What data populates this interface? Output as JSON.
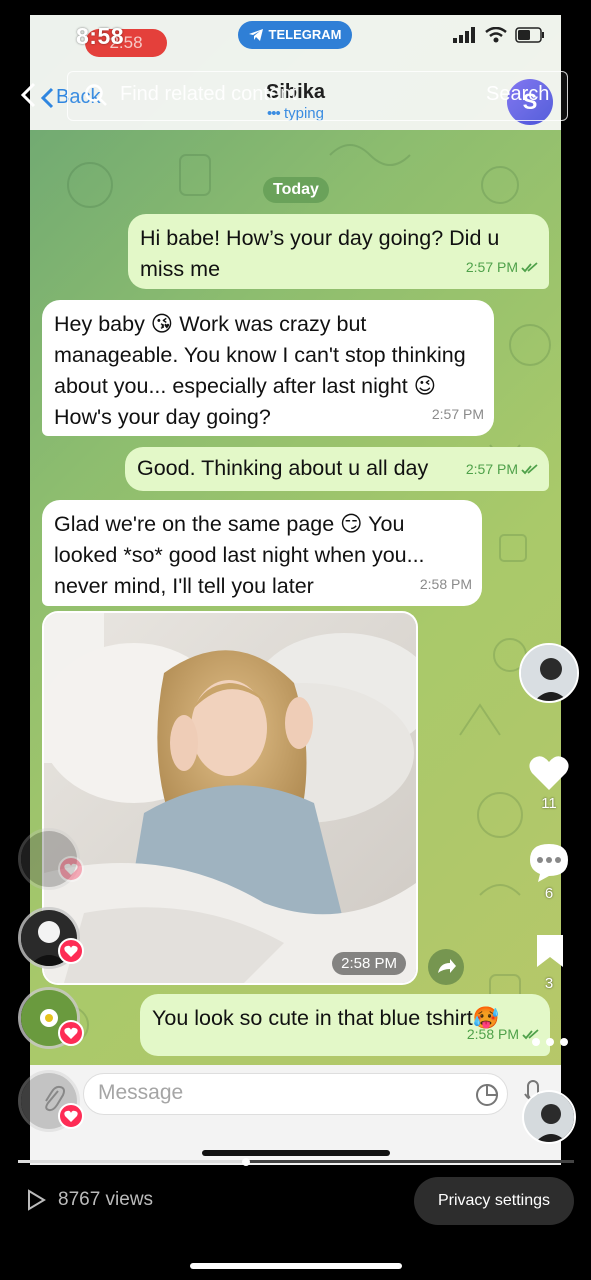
{
  "status_bar": {
    "time": "8:58",
    "recording_time": "2:58",
    "app_pill": "TELEGRAM"
  },
  "search": {
    "placeholder": "Find related content",
    "button_label": "Search"
  },
  "header": {
    "back_label": "Back",
    "contact_name": "Sibika",
    "status": "typing",
    "avatar_letter": "S"
  },
  "chat": {
    "date_chip": "Today",
    "messages": [
      {
        "dir": "out",
        "text": "Hi babe! How’s your day going? Did u miss me",
        "time": "2:57 PM",
        "read": true
      },
      {
        "dir": "in",
        "text": "Hey baby 😘 Work was crazy but manageable. You know I can't stop thinking about you... especially after last night 😉 How's your day going?",
        "time": "2:57 PM"
      },
      {
        "dir": "out",
        "text": "Good. Thinking about u all day",
        "time": "2:57 PM",
        "read": true
      },
      {
        "dir": "in",
        "text": "Glad we're on the same page 😏 You looked *so* good last night when you... never mind, I'll tell you later",
        "time": "2:58 PM"
      },
      {
        "dir": "out",
        "text": "You look so cute in that blue tshirt🥵",
        "time": "2:58 PM",
        "read": true
      }
    ],
    "photo_time": "2:58 PM"
  },
  "composer": {
    "placeholder": "Message"
  },
  "tiktok": {
    "likes": "11",
    "comments": "6",
    "saves": "3",
    "views": "8767 views",
    "privacy_label": "Privacy settings",
    "progress": 0.41
  },
  "colors": {
    "out_bubble": "#e3f8c8",
    "in_bubble": "#ffffff",
    "telegram_blue": "#2f86e0",
    "tiktok_red": "#fe2c55"
  }
}
